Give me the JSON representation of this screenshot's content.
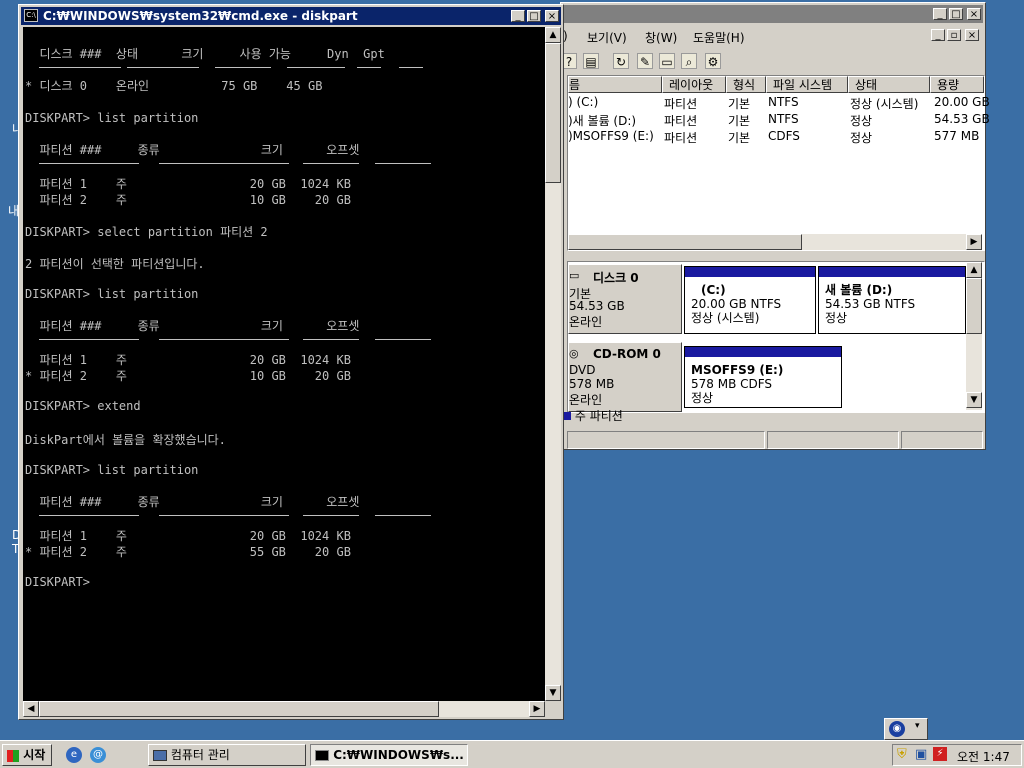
{
  "desktop": {
    "bg_color": "#3a6ea5",
    "edge_fragments": [
      "내",
      "D",
      "T"
    ]
  },
  "mgmt_window": {
    "menu": [
      ")",
      "보기(V)",
      "창(W)",
      "도움말(H)"
    ],
    "columns": [
      "름",
      "레이아웃",
      "형식",
      "파일 시스템",
      "상태",
      "용량"
    ],
    "volumes": [
      {
        "name": ") (C:)",
        "layout": "파티션",
        "type": "기본",
        "fs": "NTFS",
        "status": "정상 (시스템)",
        "size": "20.00 GB"
      },
      {
        "name": ")새 볼륨 (D:)",
        "layout": "파티션",
        "type": "기본",
        "fs": "NTFS",
        "status": "정상",
        "size": "54.53 GB"
      },
      {
        "name": ")MSOFFS9 (E:)",
        "layout": "파티션",
        "type": "기본",
        "fs": "CDFS",
        "status": "정상",
        "size": "577 MB"
      }
    ],
    "disk0": {
      "title": "디스크 0",
      "line1": "기본",
      "line2": "54.53 GB",
      "line3": "온라인",
      "p1_name": "(C:)",
      "p1_size": "20.00 GB NTFS",
      "p1_status": "정상 (시스템)",
      "p2_name": "새 볼륨 (D:)",
      "p2_size": "54.53 GB NTFS",
      "p2_status": "정상"
    },
    "cdrom0": {
      "title": "CD-ROM 0",
      "line1": "DVD",
      "line2": "578 MB",
      "line3": "온라인",
      "p_name": "MSOFFS9 (E:)",
      "p_size": "578 MB CDFS",
      "p_status": "정상"
    },
    "legend": "주 파티션"
  },
  "cmd_window": {
    "title": "C:₩WINDOWS₩system32₩cmd.exe - diskpart",
    "lines": {
      "disk_header": "  디스크 ###  상태      크기     사용 가능     Dyn  Gpt",
      "disk_row": "* 디스크 0    온라인          75 GB    45 GB",
      "cmd1": "DISKPART> list partition",
      "part_header": "  파티션 ###     종류              크기      오프셋",
      "p1_row1": "  파티션 1    주                 20 GB  1024 KB",
      "p2_row1": "  파티션 2    주                 10 GB    20 GB",
      "cmd2": "DISKPART> select partition 파티션 2",
      "msg2": "2 파티션이 선택한 파티션입니다.",
      "cmd3": "DISKPART> list partition",
      "p1_row2": "  파티션 1    주                 20 GB  1024 KB",
      "p2_row2": "* 파티션 2    주                 10 GB    20 GB",
      "cmd4": "DISKPART> extend",
      "msg4": "DiskPart에서 볼륨을 확장했습니다.",
      "cmd5": "DISKPART> list partition",
      "p1_row3": "  파티션 1    주                 20 GB  1024 KB",
      "p2_row3": "* 파티션 2    주                 55 GB    20 GB",
      "prompt": "DISKPART>"
    }
  },
  "taskbar": {
    "start_label": "시작",
    "task1": "컴퓨터 관리",
    "task2": "C:₩WINDOWS₩s...",
    "clock": "오전 1:47"
  }
}
